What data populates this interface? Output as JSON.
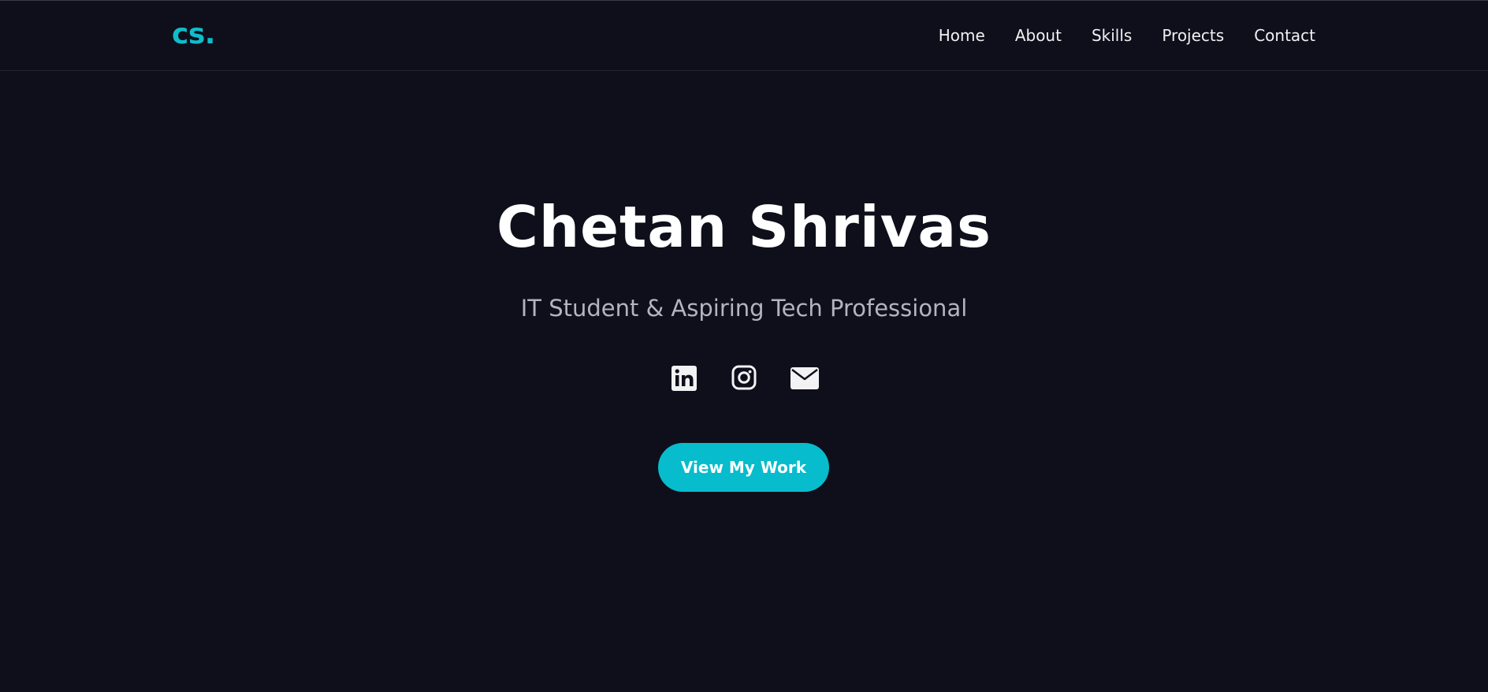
{
  "nav": {
    "logo": "cs.",
    "links": [
      "Home",
      "About",
      "Skills",
      "Projects",
      "Contact"
    ]
  },
  "hero": {
    "name": "Chetan Shrivas",
    "tagline": "IT Student & Aspiring Tech Professional",
    "socials": [
      "linkedin-icon",
      "instagram-icon",
      "mail-icon"
    ],
    "cta_label": "View My Work"
  },
  "colors": {
    "background": "#0e0f1a",
    "accent": "#07bccc",
    "text": "#ffffff",
    "muted_text": "#b4b4bf"
  }
}
